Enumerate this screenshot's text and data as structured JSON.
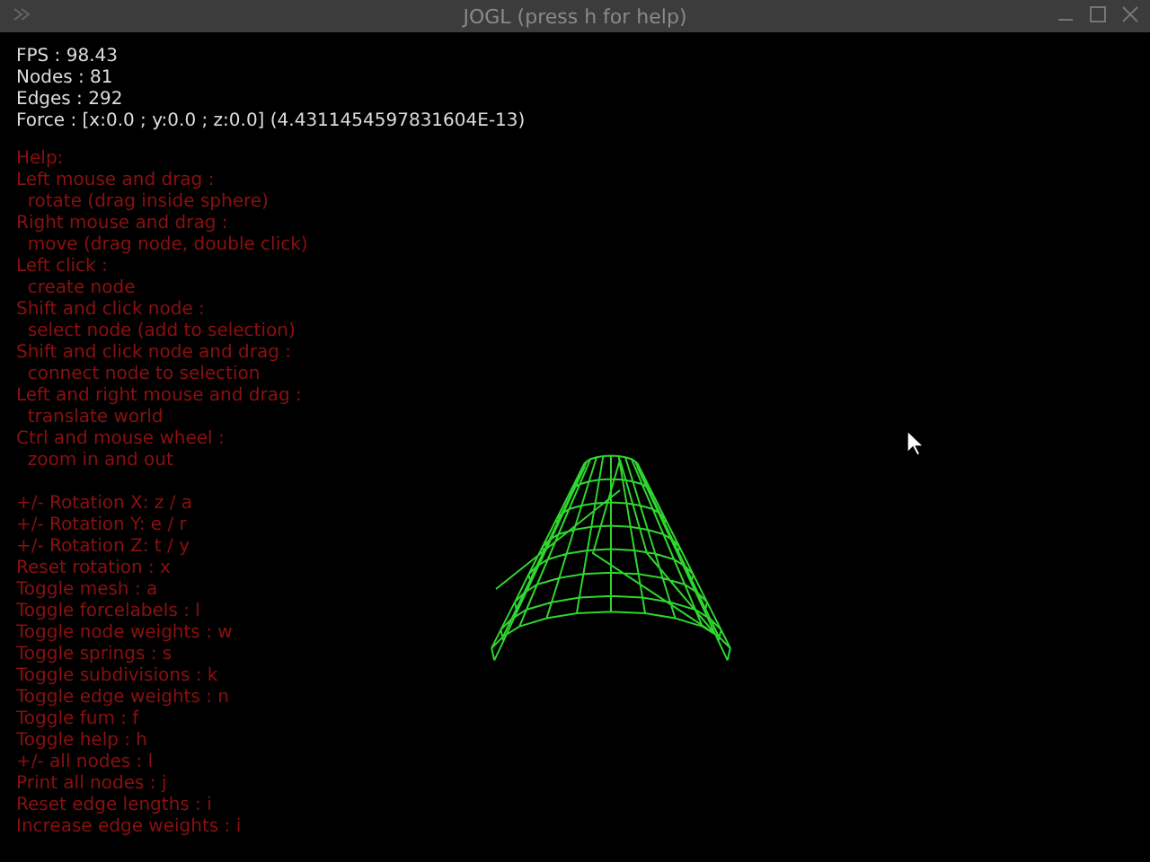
{
  "window": {
    "title": "JOGL (press h for help)"
  },
  "stats": [
    "FPS : 98.43",
    "Nodes : 81",
    "Edges : 292",
    "Force : [x:0.0 ; y:0.0 ; z:0.0] (4.4311454597831604E-13)"
  ],
  "help": [
    "Help:",
    "Left mouse and drag :",
    "  rotate (drag inside sphere)",
    "Right mouse and drag :",
    "  move (drag node, double click)",
    "Left click :",
    "  create node",
    "Shift and click node :",
    "  select node (add to selection)",
    "Shift and click node and drag :",
    "  connect node to selection",
    "Left and right mouse and drag :",
    "  translate world",
    "Ctrl and mouse wheel :",
    "  zoom in and out"
  ],
  "keys": [
    "+/- Rotation X: z / a",
    "+/- Rotation Y: e / r",
    "+/- Rotation Z: t / y",
    "Reset rotation : x",
    "Toggle mesh : a",
    "Toggle forcelabels : l",
    "Toggle node weights : w",
    "Toggle springs : s",
    "Toggle subdivisions : k",
    "Toggle edge weights : n",
    "Toggle fum : f",
    "Toggle help : h",
    "+/- all nodes : l",
    "Print all nodes : j",
    "Reset edge lengths : i",
    "Increase edge weights : i"
  ]
}
